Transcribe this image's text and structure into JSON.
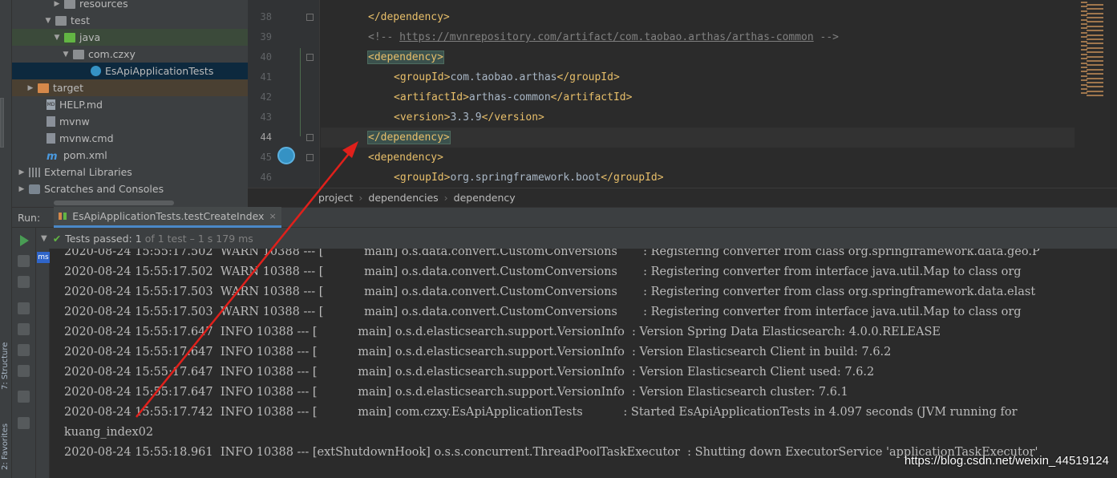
{
  "project_tree": {
    "items": [
      {
        "label": "resources",
        "icon": "folder-icon",
        "indent": 4,
        "arrow": "▶"
      },
      {
        "label": "test",
        "icon": "folder-icon",
        "indent": 3,
        "arrow": "▼"
      },
      {
        "label": "java",
        "icon": "folder-green-icon",
        "indent": 4,
        "arrow": "▼"
      },
      {
        "label": "com.czxy",
        "icon": "package-icon",
        "indent": 5,
        "arrow": "▼"
      },
      {
        "label": "EsApiApplicationTests",
        "icon": "junit-test-icon",
        "indent": 7,
        "arrow": ""
      },
      {
        "label": "target",
        "icon": "folder-orange-icon",
        "indent": 1,
        "arrow": "▶"
      },
      {
        "label": "HELP.md",
        "icon": "markdown-file-icon",
        "indent": 2,
        "arrow": ""
      },
      {
        "label": "mvnw",
        "icon": "file-icon",
        "indent": 2,
        "arrow": ""
      },
      {
        "label": "mvnw.cmd",
        "icon": "file-icon",
        "indent": 2,
        "arrow": ""
      },
      {
        "label": "pom.xml",
        "icon": "maven-icon",
        "indent": 2,
        "arrow": ""
      },
      {
        "label": "External Libraries",
        "icon": "libraries-icon",
        "indent": 0,
        "arrow": "▶"
      },
      {
        "label": "Scratches and Consoles",
        "icon": "scratches-icon",
        "indent": 0,
        "arrow": "▶"
      }
    ]
  },
  "side_tabs": {
    "structure": "7: Structure",
    "favorites": "2: Favorites"
  },
  "editor": {
    "line_numbers": [
      "38",
      "39",
      "40",
      "41",
      "42",
      "43",
      "44",
      "45",
      "46"
    ],
    "current_line": "44",
    "lines": [
      {
        "indent": 1,
        "parts": [
          {
            "cls": "tag",
            "t": "</dependency>"
          }
        ]
      },
      {
        "indent": 1,
        "parts": [
          {
            "cls": "cmt",
            "t": "<!-- "
          },
          {
            "cls": "lnk",
            "t": "https://mvnrepository.com/artifact/com.taobao.arthas/arthas-common"
          },
          {
            "cls": "cmt",
            "t": " -->"
          }
        ]
      },
      {
        "indent": 1,
        "parts": [
          {
            "cls": "tag hl",
            "t": "<dependency>"
          }
        ]
      },
      {
        "indent": 2,
        "parts": [
          {
            "cls": "tag",
            "t": "<groupId>"
          },
          {
            "cls": "txt",
            "t": "com.taobao.arthas"
          },
          {
            "cls": "tag",
            "t": "</groupId>"
          }
        ]
      },
      {
        "indent": 2,
        "parts": [
          {
            "cls": "tag",
            "t": "<artifactId>"
          },
          {
            "cls": "txt",
            "t": "arthas-common"
          },
          {
            "cls": "tag",
            "t": "</artifactId>"
          }
        ]
      },
      {
        "indent": 2,
        "parts": [
          {
            "cls": "tag",
            "t": "<version>"
          },
          {
            "cls": "txt",
            "t": "3.3.9"
          },
          {
            "cls": "tag",
            "t": "</version>"
          }
        ]
      },
      {
        "indent": 1,
        "parts": [
          {
            "cls": "tag hl",
            "t": "</dependency>"
          }
        ]
      },
      {
        "indent": 1,
        "parts": [
          {
            "cls": "tag",
            "t": "<dependency>"
          }
        ]
      },
      {
        "indent": 2,
        "parts": [
          {
            "cls": "tag",
            "t": "<groupId>"
          },
          {
            "cls": "txt",
            "t": "org.springframework.boot"
          },
          {
            "cls": "tag",
            "t": "</groupId>"
          }
        ]
      }
    ]
  },
  "breadcrumb": [
    "project",
    "dependencies",
    "dependency"
  ],
  "run_panel": {
    "title": "Run:",
    "tab_label": "EsApiApplicationTests.testCreateIndex",
    "close_glyph": "×",
    "status_prefix": "Tests passed:",
    "status_count": "1",
    "status_suffix": "of 1 test",
    "status_time": "– 1 s 179 ms",
    "ms_badge": "ms"
  },
  "console": {
    "lines": [
      "2020-08-24 15:55:17.502  WARN 10388 --- [           main] o.s.data.convert.CustomConversions       : Registering converter from class org.springframework.data.geo.P",
      "2020-08-24 15:55:17.502  WARN 10388 --- [           main] o.s.data.convert.CustomConversions       : Registering converter from interface java.util.Map to class org",
      "2020-08-24 15:55:17.503  WARN 10388 --- [           main] o.s.data.convert.CustomConversions       : Registering converter from class org.springframework.data.elast",
      "2020-08-24 15:55:17.503  WARN 10388 --- [           main] o.s.data.convert.CustomConversions       : Registering converter from interface java.util.Map to class org",
      "2020-08-24 15:55:17.647  INFO 10388 --- [           main] o.s.d.elasticsearch.support.VersionInfo  : Version Spring Data Elasticsearch: 4.0.0.RELEASE",
      "2020-08-24 15:55:17.647  INFO 10388 --- [           main] o.s.d.elasticsearch.support.VersionInfo  : Version Elasticsearch Client in build: 7.6.2",
      "2020-08-24 15:55:17.647  INFO 10388 --- [           main] o.s.d.elasticsearch.support.VersionInfo  : Version Elasticsearch Client used: 7.6.2",
      "2020-08-24 15:55:17.647  INFO 10388 --- [           main] o.s.d.elasticsearch.support.VersionInfo  : Version Elasticsearch cluster: 7.6.1",
      "2020-08-24 15:55:17.742  INFO 10388 --- [           main] com.czxy.EsApiApplicationTests           : Started EsApiApplicationTests in 4.097 seconds (JVM running for",
      "kuang_index02",
      "2020-08-24 15:55:18.961  INFO 10388 --- [extShutdownHook] o.s.s.concurrent.ThreadPoolTaskExecutor  : Shutting down ExecutorService 'applicationTaskExecutor'"
    ]
  },
  "watermark": "https://blog.csdn.net/weixin_44519124",
  "colors": {
    "tag": "#e8bf6a",
    "text": "#a9b7c6",
    "comment": "#808080",
    "passed": "#62b543",
    "annotation_arrow": "#e0201b"
  }
}
